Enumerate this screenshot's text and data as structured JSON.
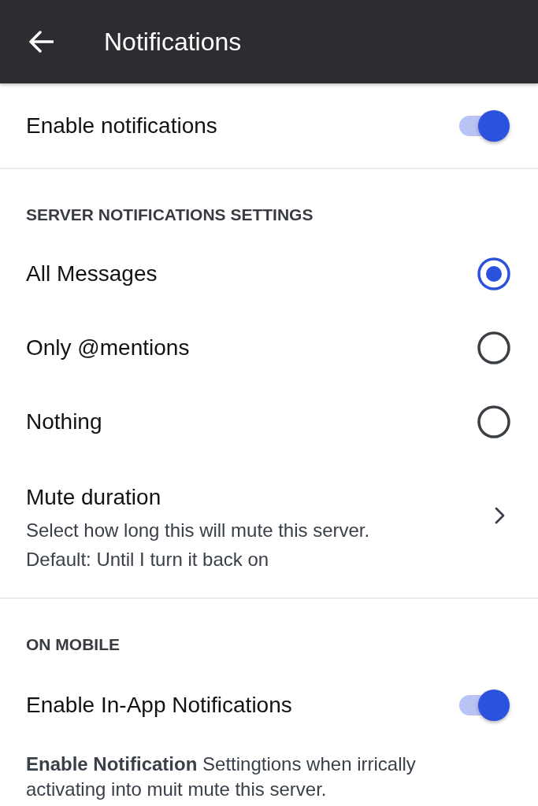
{
  "header": {
    "title": "Notifications"
  },
  "enable_notifications": {
    "label": "Enable notifications",
    "on": true
  },
  "server_section": {
    "heading": "SERVER NOTIFICATIONS SETTINGS",
    "options": [
      {
        "label": "All Messages",
        "selected": true
      },
      {
        "label": "Only @mentions",
        "selected": false
      },
      {
        "label": "Nothing",
        "selected": false
      }
    ]
  },
  "mute_duration": {
    "title": "Mute duration",
    "description_lines": [
      "Select how long this will mute this server.",
      "Default: Until I turn it back on"
    ]
  },
  "mobile_section": {
    "heading": "ON MOBILE",
    "toggle": {
      "label": "Enable In-App Notifications",
      "on": true
    },
    "description": "**Enable Notification** Settingtions when irrically activating into muit mute this server."
  }
}
